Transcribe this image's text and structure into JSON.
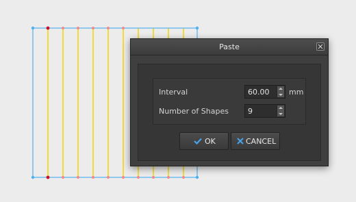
{
  "dialog": {
    "title": "Paste",
    "close_icon": "close-icon",
    "fields": {
      "interval": {
        "label": "Interval",
        "value": "60.00",
        "unit": "mm"
      },
      "number_of_shapes": {
        "label": "Number of Shapes",
        "value": "9"
      }
    },
    "buttons": {
      "ok": {
        "label": "OK",
        "icon": "check-icon"
      },
      "cancel": {
        "label": "CANCEL",
        "icon": "x-icon"
      }
    }
  },
  "colors": {
    "outline": "#4fb0ef",
    "pasted_lines": "#f5d400",
    "anchor_point": "#c8102e",
    "node_point": "#f08a8a",
    "accent": "#4aa3e8"
  }
}
